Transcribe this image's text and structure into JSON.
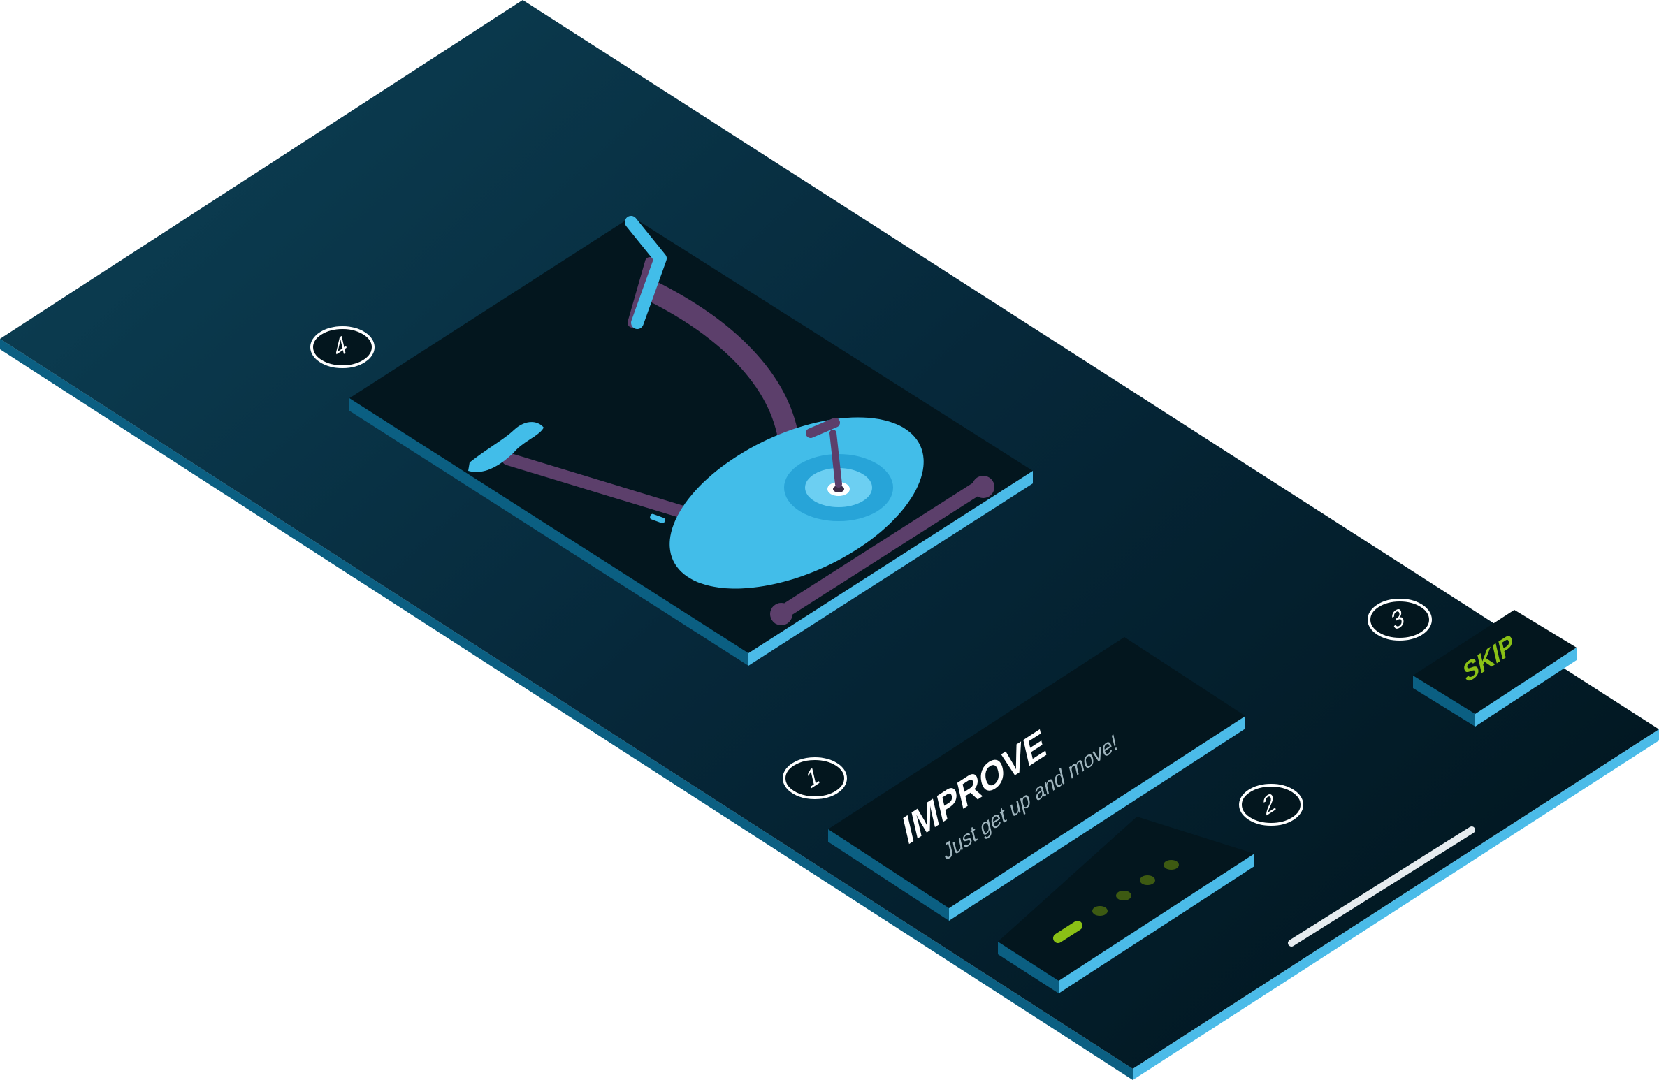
{
  "app": {
    "screen": "onboarding-walkthrough"
  },
  "hero": {
    "illustration": "exercise-bike-icon"
  },
  "onboarding": {
    "title": "IMPROVE",
    "subtitle": "Just get up and move!",
    "skip_label": "SKIP",
    "page_indicator": {
      "total": 5,
      "active": 1
    }
  },
  "callouts": [
    {
      "number": "1",
      "target": "title-card"
    },
    {
      "number": "2",
      "target": "page-indicator"
    },
    {
      "number": "3",
      "target": "skip-button"
    },
    {
      "number": "4",
      "target": "illustration-card"
    }
  ],
  "colors": {
    "panel_dark": "#0a3347",
    "panel_deep": "#021a24",
    "edge_light": "#4bbbe8",
    "edge_dark": "#0b5f82",
    "card": "#03161e",
    "accent_green": "#8ac016",
    "bike_blue": "#42bde9",
    "bike_purple": "#5c3f6b",
    "text_white": "#ffffff",
    "text_muted": "#9fb4bd"
  }
}
